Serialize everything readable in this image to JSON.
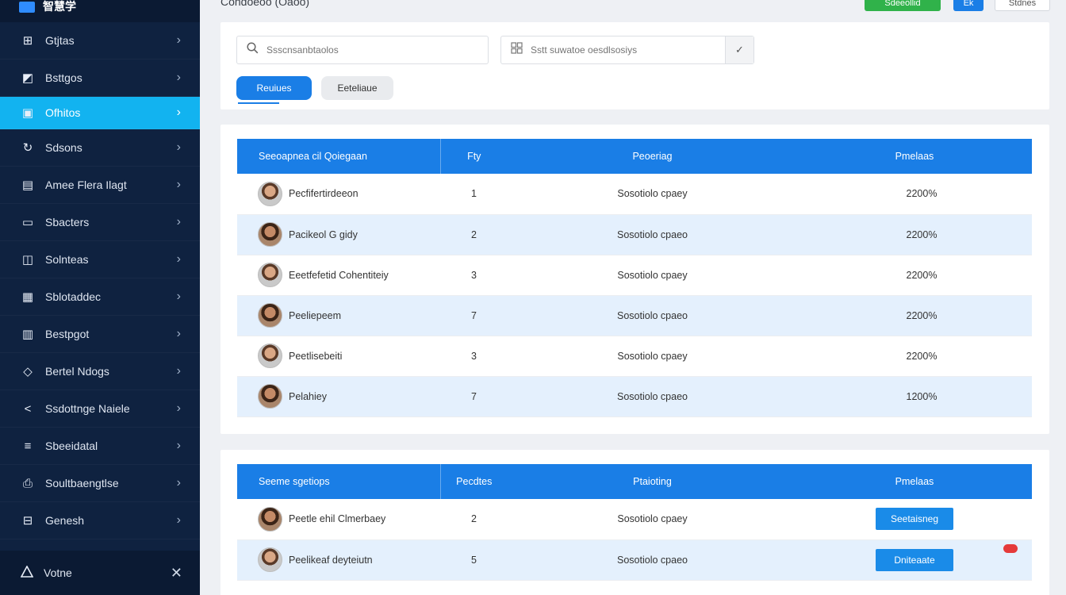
{
  "brand": {
    "title": "智慧学"
  },
  "header": {
    "breadcrumb": "Condoeoo (Oaoo)",
    "green_button": "Sdeeollid",
    "blue_button": "Ek",
    "white_button": "Stdnes"
  },
  "sidebar": {
    "items": [
      {
        "label": "Gtjtas",
        "icon": "grid-icon"
      },
      {
        "label": "Bsttgos",
        "icon": "image-icon"
      },
      {
        "label": "Ofhitos",
        "icon": "folder-icon",
        "active": true
      },
      {
        "label": "Sdsons",
        "icon": "refresh-icon"
      },
      {
        "label": "Amee Flera Ilagt",
        "icon": "document-icon"
      },
      {
        "label": "Sbacters",
        "icon": "card-icon"
      },
      {
        "label": "Solnteas",
        "icon": "book-icon"
      },
      {
        "label": "Sblotaddec",
        "icon": "calendar-icon"
      },
      {
        "label": "Bestpgot",
        "icon": "layout-icon"
      },
      {
        "label": "Bertel Ndogs",
        "icon": "tag-icon"
      },
      {
        "label": "Ssdottnge Naiele",
        "icon": "share-icon"
      },
      {
        "label": "Sbeeidatal",
        "icon": "list-icon"
      },
      {
        "label": "Soultbaengtlse",
        "icon": "print-icon"
      },
      {
        "label": "Genesh",
        "icon": "network-icon"
      }
    ],
    "footer": {
      "label": "Votne",
      "icon": "warning-icon"
    }
  },
  "filters": {
    "search_placeholder": "Ssscnsanbtaolos",
    "select_placeholder": "Sstt suwatoe oesdlsosiys",
    "tab_active": "Reuiues",
    "tab_inactive": "Eeteliaue"
  },
  "table1": {
    "headers": [
      "Seeoapnea cil Qoiegaan",
      "Fty",
      "Peoeriag",
      "Pmelaas"
    ],
    "rows": [
      {
        "name": "Pecfifertirdeeon",
        "qty": "1",
        "status": "Sosotiolo cpaey",
        "pct": "2200%"
      },
      {
        "name": "Pacikeol G gidy",
        "qty": "2",
        "status": "Sosotiolo cpaeo",
        "pct": "2200%"
      },
      {
        "name": "Eeetfefetid Cohentiteiy",
        "qty": "3",
        "status": "Sosotiolo cpaey",
        "pct": "2200%"
      },
      {
        "name": "Peeliepeem",
        "qty": "7",
        "status": "Sosotiolo cpaeo",
        "pct": "2200%"
      },
      {
        "name": "Peetlisebeiti",
        "qty": "3",
        "status": "Sosotiolo cpaey",
        "pct": "2200%"
      },
      {
        "name": "Pelahiey",
        "qty": "7",
        "status": "Sosotiolo cpaeo",
        "pct": "1200%"
      }
    ]
  },
  "table2": {
    "headers": [
      "Seeme sgetiops",
      "Pecdtes",
      "Ptaioting",
      "Pmelaas"
    ],
    "rows": [
      {
        "name": "Peetle ehil Clmerbaey",
        "qty": "2",
        "status": "Sosotiolo cpaey",
        "action": "Seetaisneg"
      },
      {
        "name": "Peelikeaf deyteiutn",
        "qty": "5",
        "status": "Sosotiolo cpaeo",
        "action": "Dniteaate"
      }
    ]
  },
  "colors": {
    "sidebar_bg": "#0f2240",
    "active": "#12b3f0",
    "primary": "#1a7ee6",
    "green": "#30b24a"
  }
}
